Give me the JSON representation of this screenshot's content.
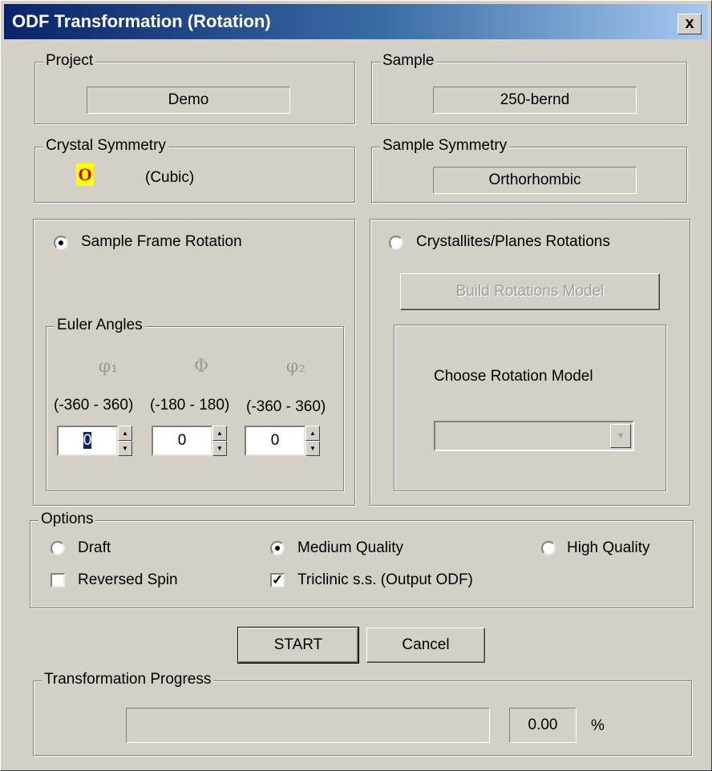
{
  "window": {
    "title": "ODF Transformation (Rotation)",
    "close_label": "x"
  },
  "project": {
    "label": "Project",
    "value": "Demo"
  },
  "sample": {
    "label": "Sample",
    "value": "250-bernd"
  },
  "crystal_symmetry": {
    "label": "Crystal Symmetry",
    "icon_letter": "O",
    "value": "(Cubic)"
  },
  "sample_symmetry": {
    "label": "Sample Symmetry",
    "value": "Orthorhombic"
  },
  "sample_frame": {
    "radio_label": "Sample Frame Rotation",
    "selected": true,
    "euler": {
      "label": "Euler Angles",
      "angles": [
        {
          "symbol": "φ₁",
          "range": "(-360 - 360)",
          "value": "0"
        },
        {
          "symbol": "Φ",
          "range": "(-180 - 180)",
          "value": "0"
        },
        {
          "symbol": "φ₂",
          "range": "(-360 - 360)",
          "value": "0"
        }
      ]
    }
  },
  "crystallites": {
    "radio_label": "Crystallites/Planes Rotations",
    "selected": false,
    "build_button": "Build Rotations Model",
    "choose_label": "Choose  Rotation Model",
    "dropdown_value": ""
  },
  "options": {
    "label": "Options",
    "quality": [
      {
        "label": "Draft",
        "selected": false
      },
      {
        "label": "Medium Quality",
        "selected": true
      },
      {
        "label": "High Quality",
        "selected": false
      }
    ],
    "reversed_spin": {
      "label": "Reversed Spin",
      "checked": false
    },
    "triclinic": {
      "label": "Triclinic s.s. (Output ODF)",
      "checked": true
    }
  },
  "buttons": {
    "start": "START",
    "cancel": "Cancel"
  },
  "progress": {
    "label": "Transformation Progress",
    "value": "0.00",
    "unit": "%",
    "fraction": 0.0
  }
}
